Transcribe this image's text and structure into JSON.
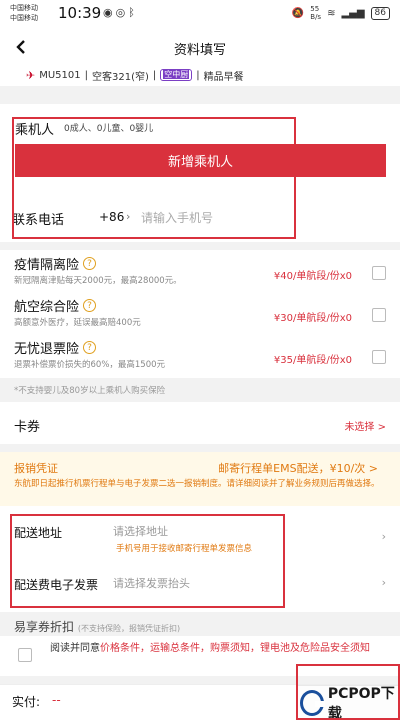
{
  "status_bar": {
    "carrier_1": "中国移动",
    "carrier_2": "中国移动",
    "time": "10:39",
    "network_speed": "55\nB/s",
    "battery": "86"
  },
  "nav": {
    "title": "资料填写"
  },
  "flight": {
    "number": "MU5101",
    "aircraft": "空客321(窄)",
    "meal_badge": "空中厨",
    "meal": "精品早餐"
  },
  "passengers": {
    "label": "乘机人",
    "count_text": "0成人、0儿童、0婴儿",
    "add_button": "新增乘机人",
    "phone_label": "联系电话",
    "phone_code": "+86",
    "phone_placeholder": "请输入手机号"
  },
  "insurance": {
    "items": [
      {
        "name": "疫情隔离险",
        "desc": "新冠隔离津贴每天2000元，最高28000元。",
        "price": "¥40/单航段/份x0"
      },
      {
        "name": "航空综合险",
        "desc": "高额意外医疗，延误最高赔400元",
        "price": "¥30/单航段/份x0"
      },
      {
        "name": "无忧退票险",
        "desc": "退票补偿票价损失的60%，最高1500元",
        "price": "¥35/单航段/份x0"
      }
    ],
    "note": "*不支持婴儿及80岁以上乘机人购买保险"
  },
  "coupon": {
    "label": "卡券",
    "value": "未选择 >"
  },
  "invoice": {
    "label": "报销凭证",
    "method": "邮寄行程单EMS配送，¥10/次 >",
    "desc": "东航即日起推行机票行程单与电子发票二选一报销制度。请详细阅读并了解业务规则后再做选择。"
  },
  "delivery": {
    "address_label": "配送地址",
    "address_placeholder": "请选择地址",
    "address_hint": "手机号用于接收邮寄行程单发票信息",
    "invoice_label": "配送费电子发票",
    "invoice_placeholder": "请选择发票抬头"
  },
  "partial_row": {
    "text": "易享券折扣",
    "sub": "(不支持保险，报销凭证折扣)"
  },
  "agreement": {
    "prefix": "阅读并同意",
    "links": "价格条件，运输总条件，购票须知，锂电池及危险品安全须知"
  },
  "pay": {
    "label": "实付:",
    "amount": "--"
  },
  "watermark": {
    "text": "PCPOP下载"
  },
  "colors": {
    "accent": "#d9313d",
    "warning": "#e07a12"
  }
}
